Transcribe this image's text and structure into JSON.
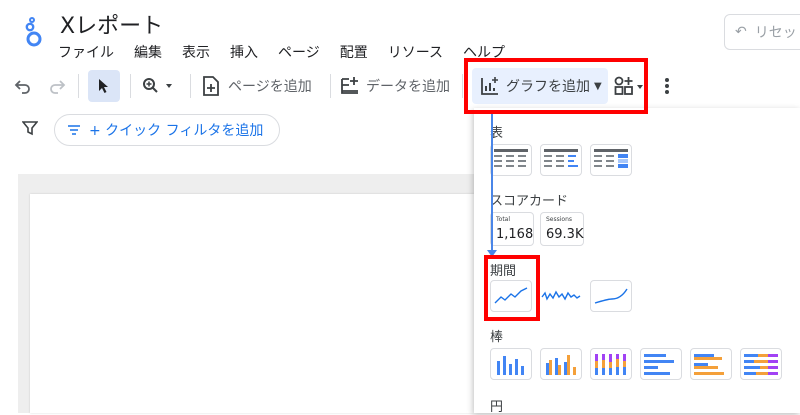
{
  "header": {
    "title": "Xレポート",
    "menu": [
      "ファイル",
      "編集",
      "表示",
      "挿入",
      "ページ",
      "配置",
      "リソース",
      "ヘルプ"
    ],
    "reset_label": "リセット"
  },
  "toolbar": {
    "add_page_label": "ページを追加",
    "add_data_label": "データを追加",
    "add_chart_label": "グラフを追加"
  },
  "filter": {
    "quick_filter_label": "+ クイック フィルタを追加"
  },
  "chart_menu": {
    "table_label": "表",
    "scorecard_label": "スコアカード",
    "timeseries_label": "期間",
    "bar_label": "棒",
    "pie_label": "円",
    "scorecards": [
      {
        "label": "Total",
        "value": "1,168"
      },
      {
        "label": "Sessions",
        "value": "69.3K"
      }
    ]
  },
  "colors": {
    "accent": "#1a73e8",
    "highlight": "#ff0000",
    "bar_orange": "#f4a03a",
    "bar_purple": "#a142f4"
  }
}
